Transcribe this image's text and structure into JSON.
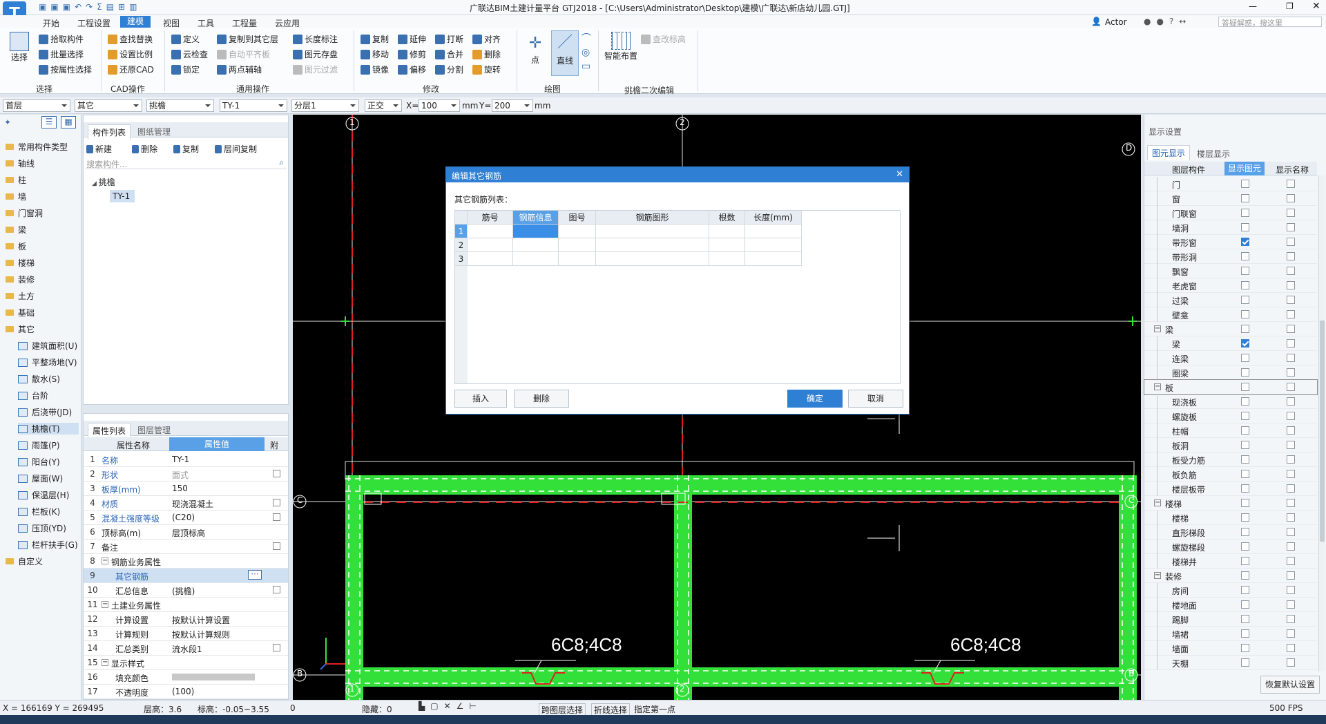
{
  "titlebar": {
    "title": "广联达BIM土建计量平台 GTJ2018 - [C:\\Users\\Administrator\\Desktop\\建模\\广联达\\新店幼儿园.GTJ]",
    "user": "Actor",
    "search_placeholder": "答疑解惑，搜这里"
  },
  "menus": [
    "开始",
    "工程设置",
    "建模",
    "视图",
    "工具",
    "工程量",
    "云应用"
  ],
  "ribbon": {
    "select_big": "选择",
    "select_group": [
      "拾取构件",
      "批量选择",
      "按属性选择"
    ],
    "select_label": "选择",
    "cad_group": [
      "查找替换",
      "设置比例",
      "还原CAD"
    ],
    "cad_label": "CAD操作",
    "general_col1": [
      "定义",
      "云检查",
      "锁定"
    ],
    "general_col2": [
      "复制到其它层",
      "自动平齐板",
      "两点辅轴"
    ],
    "general_col3": [
      "长度标注",
      "图元存盘",
      "图元过滤"
    ],
    "general_label": "通用操作",
    "modify_col1": [
      "复制",
      "移动",
      "镜像"
    ],
    "modify_col2": [
      "延伸",
      "修剪",
      "偏移"
    ],
    "modify_col3": [
      "打断",
      "合并",
      "分割"
    ],
    "modify_col4": [
      "对齐",
      "删除",
      "旋转"
    ],
    "modify_label": "修改",
    "draw_point": "点",
    "draw_line": "直线",
    "draw_label": "绘图",
    "smart": "智能布置",
    "smart_label": "挑檐二次编辑",
    "check_annotation": "查改标高"
  },
  "toolbar2": {
    "floor": "首层",
    "category": "其它",
    "type": "挑檐",
    "component": "TY-1",
    "layer": "分层1",
    "mode": "正交",
    "x_label": "X=",
    "x_value": "100",
    "y_label": "Y=",
    "y_value": "200",
    "unit": "mm"
  },
  "leftnav": {
    "folders": [
      "常用构件类型",
      "轴线",
      "柱",
      "墙",
      "门窗洞",
      "梁",
      "板",
      "楼梯",
      "装修",
      "土方",
      "基础",
      "其它"
    ],
    "others": [
      "建筑面积(U)",
      "平整场地(V)",
      "散水(S)",
      "台阶",
      "后浇带(JD)",
      "挑檐(T)",
      "雨篷(P)",
      "阳台(Y)",
      "屋面(W)",
      "保温层(H)",
      "栏板(K)",
      "压顶(YD)",
      "栏杆扶手(G)"
    ],
    "custom": "自定义"
  },
  "complist": {
    "tab_active": "构件列表",
    "tab_other": "图纸管理",
    "new_btn": "新建",
    "delete_btn": "删除",
    "copy_btn": "复制",
    "copy_floor_btn": "层间复制",
    "search_placeholder": "搜索构件...",
    "tree_parent": "挑檐",
    "tree_child": "TY-1"
  },
  "proplist": {
    "tab_active": "属性列表",
    "tab_other": "图层管理",
    "col_name": "属性名称",
    "col_value": "属性值",
    "col_attach": "附",
    "rows": [
      {
        "n": "1",
        "k": "名称",
        "v": "TY-1"
      },
      {
        "n": "2",
        "k": "形状",
        "v": "面式"
      },
      {
        "n": "3",
        "k": "板厚(mm)",
        "v": "150"
      },
      {
        "n": "4",
        "k": "材质",
        "v": "现浇混凝土"
      },
      {
        "n": "5",
        "k": "混凝土强度等级",
        "v": "(C20)"
      },
      {
        "n": "6",
        "k": "顶标高(m)",
        "v": "层顶标高"
      },
      {
        "n": "7",
        "k": "备注",
        "v": ""
      },
      {
        "n": "8",
        "k": "钢筋业务属性",
        "v": ""
      },
      {
        "n": "9",
        "k": "其它钢筋",
        "v": ""
      },
      {
        "n": "10",
        "k": "汇总信息",
        "v": "(挑檐)"
      },
      {
        "n": "11",
        "k": "土建业务属性",
        "v": ""
      },
      {
        "n": "12",
        "k": "计算设置",
        "v": "按默认计算设置"
      },
      {
        "n": "13",
        "k": "计算规则",
        "v": "按默认计算规则"
      },
      {
        "n": "14",
        "k": "汇总类别",
        "v": "流水段1"
      },
      {
        "n": "15",
        "k": "显示样式",
        "v": ""
      },
      {
        "n": "16",
        "k": "填充颜色",
        "v": ""
      },
      {
        "n": "17",
        "k": "不透明度",
        "v": "(100)"
      }
    ]
  },
  "canvas": {
    "axis_labels_top": [
      "1",
      "2"
    ],
    "axis_labels_side": [
      "D",
      "C",
      "C",
      "B",
      "B"
    ],
    "rebar_label_1": "6C8;4C8",
    "rebar_label_2": "6C8;4C8",
    "bottom_axis": [
      "1",
      "2"
    ]
  },
  "dialog": {
    "title": "编辑其它钢筋",
    "list_label": "其它钢筋列表：",
    "columns": [
      "筋号",
      "钢筋信息",
      "图号",
      "钢筋图形",
      "根数",
      "长度(mm)"
    ],
    "row_numbers": [
      "1",
      "2",
      "3"
    ],
    "btn_insert": "插入",
    "btn_delete": "删除",
    "btn_ok": "确定",
    "btn_cancel": "取消"
  },
  "dispset": {
    "title": "显示设置",
    "tab_active": "图元显示",
    "tab_other": "楼层显示",
    "col_layer": "图层构件",
    "col_show": "显示图元",
    "col_name": "显示名称",
    "rows": [
      {
        "label": "门",
        "lvl": 2,
        "show": false
      },
      {
        "label": "窗",
        "lvl": 2,
        "show": false
      },
      {
        "label": "门联窗",
        "lvl": 2,
        "show": false
      },
      {
        "label": "墙洞",
        "lvl": 2,
        "show": false
      },
      {
        "label": "带形窗",
        "lvl": 2,
        "show": true
      },
      {
        "label": "带形洞",
        "lvl": 2,
        "show": false
      },
      {
        "label": "飘窗",
        "lvl": 2,
        "show": false
      },
      {
        "label": "老虎窗",
        "lvl": 2,
        "show": false
      },
      {
        "label": "过梁",
        "lvl": 2,
        "show": false
      },
      {
        "label": "壁龛",
        "lvl": 2,
        "show": false
      },
      {
        "label": "梁",
        "lvl": 1,
        "show": false
      },
      {
        "label": "梁",
        "lvl": 2,
        "show": true
      },
      {
        "label": "连梁",
        "lvl": 2,
        "show": false
      },
      {
        "label": "圈梁",
        "lvl": 2,
        "show": false
      },
      {
        "label": "板",
        "lvl": 1,
        "show": false
      },
      {
        "label": "现浇板",
        "lvl": 2,
        "show": false
      },
      {
        "label": "螺旋板",
        "lvl": 2,
        "show": false
      },
      {
        "label": "柱帽",
        "lvl": 2,
        "show": false
      },
      {
        "label": "板洞",
        "lvl": 2,
        "show": false
      },
      {
        "label": "板受力筋",
        "lvl": 2,
        "show": false
      },
      {
        "label": "板负筋",
        "lvl": 2,
        "show": false
      },
      {
        "label": "楼层板带",
        "lvl": 2,
        "show": false
      },
      {
        "label": "楼梯",
        "lvl": 1,
        "show": false
      },
      {
        "label": "楼梯",
        "lvl": 2,
        "show": false
      },
      {
        "label": "直形梯段",
        "lvl": 2,
        "show": false
      },
      {
        "label": "螺旋梯段",
        "lvl": 2,
        "show": false
      },
      {
        "label": "楼梯井",
        "lvl": 2,
        "show": false
      },
      {
        "label": "装修",
        "lvl": 1,
        "show": false
      },
      {
        "label": "房间",
        "lvl": 2,
        "show": false
      },
      {
        "label": "楼地面",
        "lvl": 2,
        "show": false
      },
      {
        "label": "踢脚",
        "lvl": 2,
        "show": false
      },
      {
        "label": "墙裙",
        "lvl": 2,
        "show": false
      },
      {
        "label": "墙面",
        "lvl": 2,
        "show": false
      },
      {
        "label": "天棚",
        "lvl": 2,
        "show": false
      }
    ],
    "restore_btn": "恢复默认设置"
  },
  "statusbar": {
    "coords": "X = 166169 Y = 269495",
    "floor_height": "层高：3.6",
    "elevation": "标高：-0.05~3.55",
    "zero": "0",
    "hidden": "隐藏：0",
    "cross_select": "跨图层选择",
    "polyline_select": "折线选择",
    "hint": "指定第一点",
    "fps": "500 FPS"
  },
  "colors": {
    "accent": "#2f7fd4",
    "beam_green": "#33e03a",
    "axis_red": "#e0201e"
  }
}
